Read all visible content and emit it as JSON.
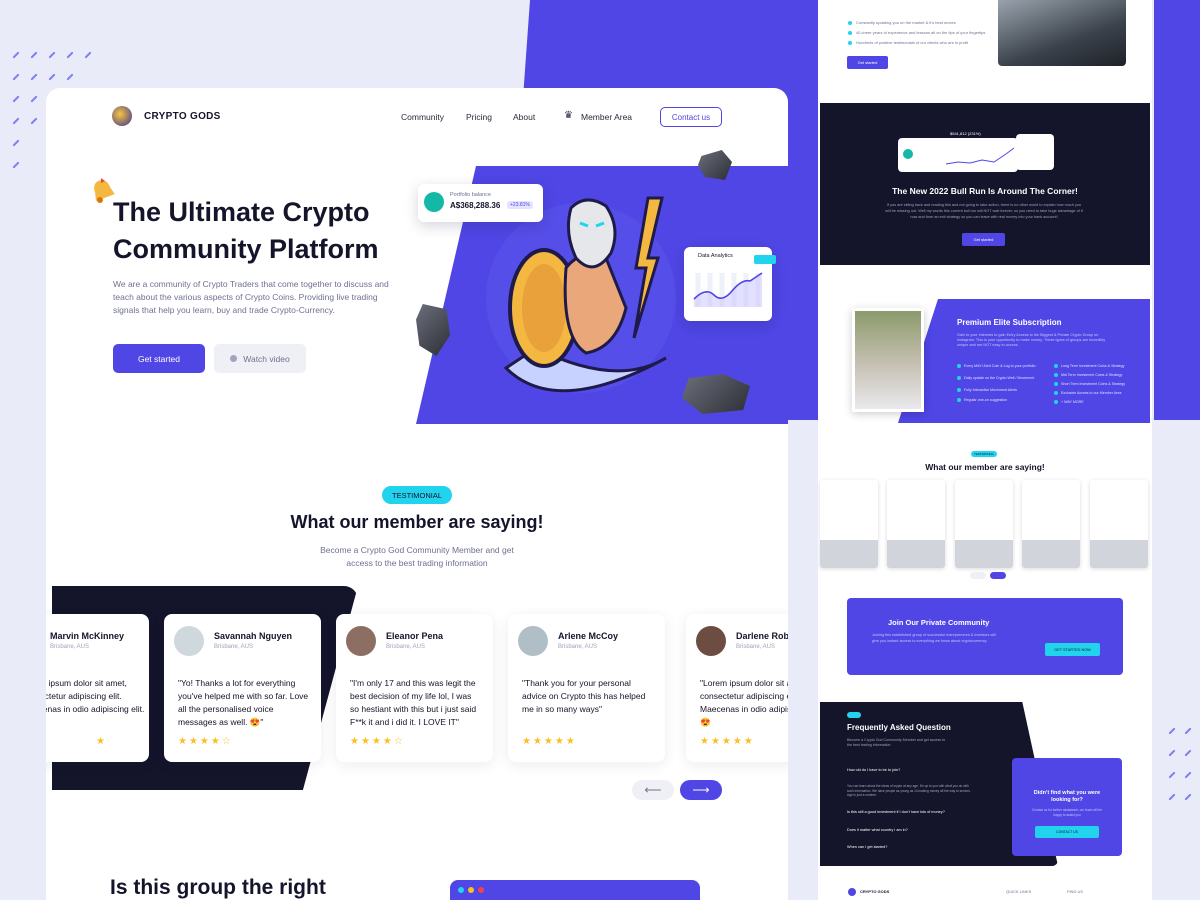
{
  "brand": {
    "name": "CRYPTO GODS"
  },
  "nav": {
    "links": [
      "Community",
      "Pricing",
      "About"
    ],
    "member_area": "Member Area",
    "contact": "Contact us"
  },
  "hero": {
    "title": "The Ultimate Crypto Community Platform",
    "description": "We are a community of Crypto Traders that come together to discuss and teach about the various aspects of Crypto Coins. Providing live trading signals that help you learn, buy and trade Crypto-Currency.",
    "cta_primary": "Get started",
    "cta_secondary": "Watch video",
    "portfolio": {
      "label": "Portfolio balance",
      "value": "A$368,288.36",
      "change": "+23.81%"
    },
    "analytics": {
      "title": "Data Analytics"
    }
  },
  "testimonials": {
    "badge": "TESTIMONIAL",
    "title": "What our member are saying!",
    "description": "Become a Crypto God Community Member and get access to the best trading information",
    "items": [
      {
        "name": "Marvin McKinney",
        "location": "Brisbane, AUS",
        "quote": "Lorem ipsum dolor sit amet, consectetur adipiscing elit. Maecenas in odio adipiscing elit.",
        "stars": "★"
      },
      {
        "name": "Savannah Nguyen",
        "location": "Brisbane, AUS",
        "quote": "\"Yo! Thanks a lot for everything you've helped me with so far. Love all the personalised voice messages as well. 😍\"",
        "stars": "★★★★☆"
      },
      {
        "name": "Eleanor Pena",
        "location": "Brisbane, AUS",
        "quote": "\"I'm only 17 and this was legit the best decision of my life lol, I was so hestiant with this but i just said F**k it and i did it. I LOVE IT\"",
        "stars": "★★★★☆"
      },
      {
        "name": "Arlene McCoy",
        "location": "Brisbane, AUS",
        "quote": "\"Thank you for your personal advice on Crypto this has helped me in so many ways\"",
        "stars": "★★★★★"
      },
      {
        "name": "Darlene Robertson",
        "location": "Brisbane, AUS",
        "quote": "\"Lorem ipsum dolor sit amet, consectetur adipiscing elit. Maecenas in odio adipiscing 😍",
        "stars": "★★★★★"
      }
    ],
    "prev": "⟵",
    "next": "⟶"
  },
  "next_section": {
    "title": "Is this group the right"
  },
  "preview": {
    "get_started": "Get started",
    "checks": [
      "Constantly updating you on the market & it's best moves",
      "40 cheer years of experience and lessons all on the tips of your fingertips",
      "Hundreds of positive testimonials of our clients who are in profit"
    ],
    "bull_run": {
      "title": "The New 2022 Bull Run Is Around The Corner!",
      "description": "If you are sitting back and reading this and not going to take action, there is no other world to explain how much you will be missing out. Well my words this current bull run will NOT wait forever, so you need to take huge advantage of it now and form an exit strategy so you can leave with real money into your bank account!",
      "button": "Get started",
      "stat": "$541,812 (231%)"
    },
    "premium": {
      "title": "Premium Elite Subscription",
      "description": "Gain to your interests to gain Entry Access to the Biggest & Private Crypto Group on Instagram. This is your opportunity to make money. These types of groups are incredibly unique and are NOT easy to access.",
      "left_checks": [
        "Every MAY! Alert Coin & Log to your portfolio",
        "Daily update on the Crypto Well / Movement",
        "Fully Interactive Movement Alerts",
        "Regular one-on suggestion"
      ],
      "right_checks": [
        "Long Term Investment Coins & Strategy",
        "Mid Term Investment Coins & Strategy",
        "Short Term Investment Coins & Strategy",
        "Exclusive Access to our Member Area",
        "+ WAY MORE"
      ]
    },
    "testimonials": {
      "badge": "TESTIMONIAL",
      "title": "What our member are saying!"
    },
    "join": {
      "title": "Join Our Private Community",
      "description": "Joining this established group of successful entrepreneurs & investors will give you instant access to everything we know about cryptocurrency.",
      "button": "GET STARTED NOW"
    },
    "faq": {
      "title": "Frequently Asked Question",
      "description": "Become a Crypto God Community Member and get access to the best trading information",
      "questions": [
        "How old do I have to be to join?",
        "Is this still a good investment if I don't have lots of money?",
        "Does it matter what country I am in?",
        "When can I get started?"
      ],
      "answer": "You can learn about the ideas of crypto at any age. It's up to you with what you do with such information. We have people as young as 14 making money all the way to seniors. Age is just a number.",
      "card_title": "Didn't find what you were looking for?",
      "card_desc": "Contact us for further assistance, our team will be happy to assist you",
      "card_button": "CONTACT US"
    },
    "footer": {
      "brand": "CRYPTO GODS",
      "col1": "QUICK LINKS",
      "col2": "FIND US"
    }
  }
}
